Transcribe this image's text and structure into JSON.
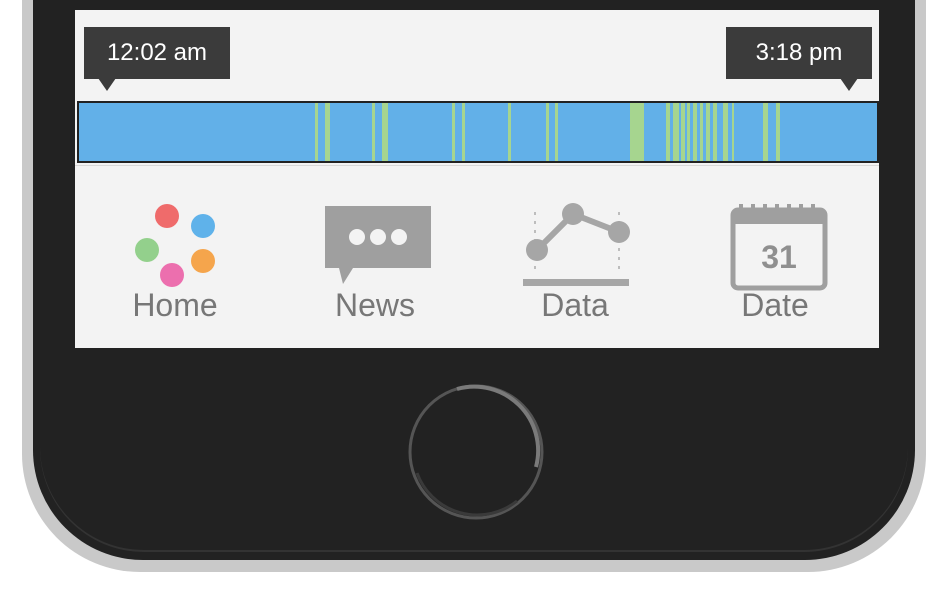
{
  "timeline": {
    "start_label": "12:02 am",
    "end_label": "3:18 pm",
    "colors": {
      "background": "#62b0e8",
      "active": "#a6d58f"
    },
    "active_segments": [
      [
        0.296,
        0.3
      ],
      [
        0.308,
        0.314
      ],
      [
        0.367,
        0.371
      ],
      [
        0.38,
        0.387
      ],
      [
        0.467,
        0.471
      ],
      [
        0.48,
        0.484
      ],
      [
        0.537,
        0.541
      ],
      [
        0.585,
        0.589
      ],
      [
        0.596,
        0.6
      ],
      [
        0.69,
        0.708
      ],
      [
        0.736,
        0.741
      ],
      [
        0.744,
        0.752
      ],
      [
        0.755,
        0.759
      ],
      [
        0.762,
        0.766
      ],
      [
        0.77,
        0.774
      ],
      [
        0.778,
        0.782
      ],
      [
        0.786,
        0.791
      ],
      [
        0.794,
        0.8
      ],
      [
        0.807,
        0.813
      ],
      [
        0.818,
        0.821
      ],
      [
        0.857,
        0.864
      ],
      [
        0.873,
        0.879
      ]
    ]
  },
  "tabs": [
    {
      "label": "Home",
      "icon": "home-dots-icon"
    },
    {
      "label": "News",
      "icon": "chat-bubble-icon"
    },
    {
      "label": "Data",
      "icon": "line-chart-icon"
    },
    {
      "label": "Date",
      "icon": "calendar-icon",
      "icon_text": "31"
    }
  ],
  "home_dot_colors": [
    "#ef6b6b",
    "#5fb2ea",
    "#93d08c",
    "#f5a54c",
    "#ec6fae"
  ]
}
